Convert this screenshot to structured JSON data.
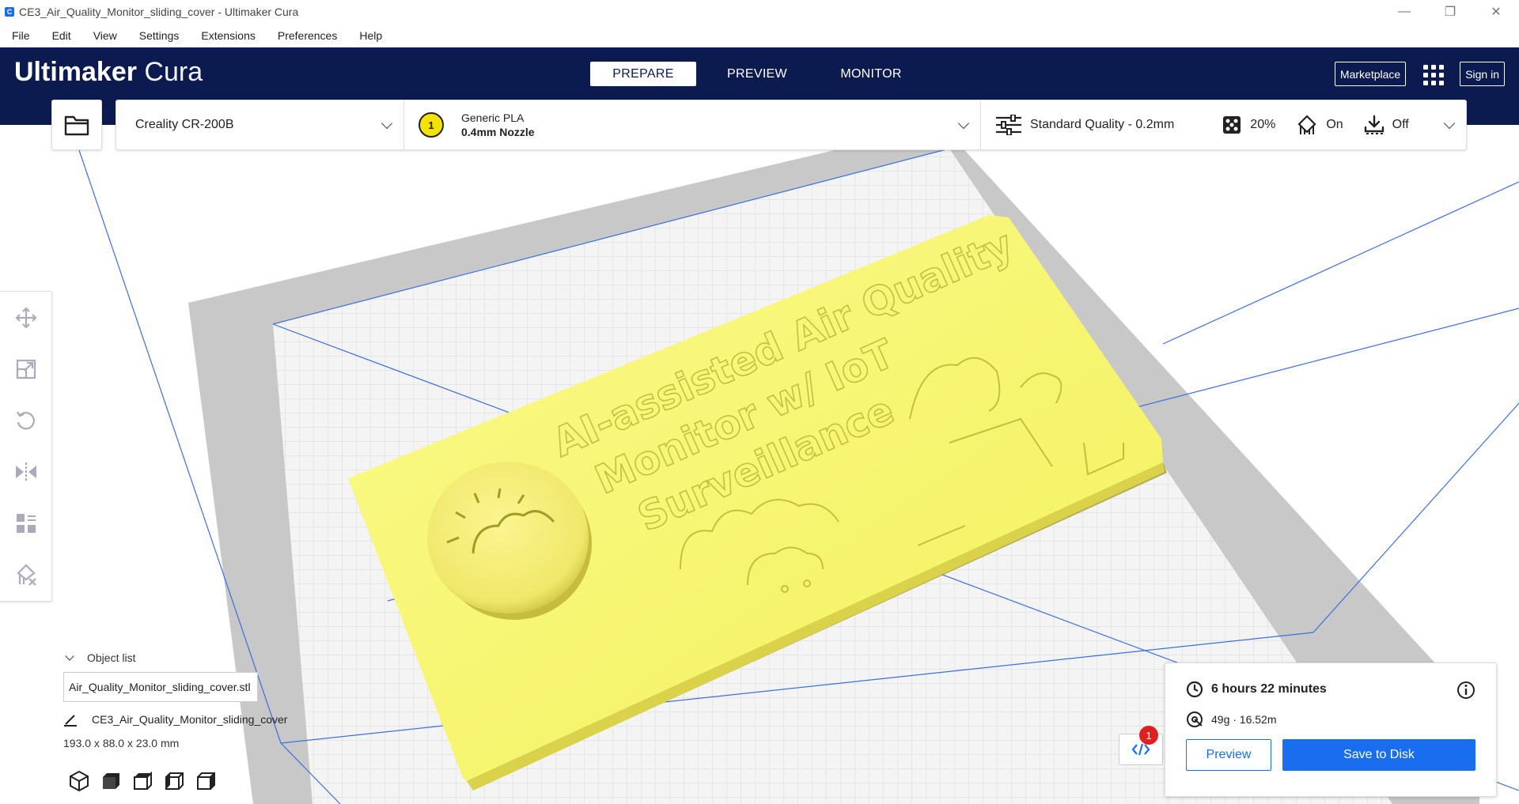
{
  "window": {
    "title": "CE3_Air_Quality_Monitor_sliding_cover - Ultimaker Cura",
    "app_icon": "C"
  },
  "menu": [
    {
      "label": "File"
    },
    {
      "label": "Edit"
    },
    {
      "label": "View"
    },
    {
      "label": "Settings"
    },
    {
      "label": "Extensions"
    },
    {
      "label": "Preferences"
    },
    {
      "label": "Help"
    }
  ],
  "header": {
    "brand_bold": "Ultimaker",
    "brand_light": "Cura",
    "stages": [
      {
        "label": "PREPARE",
        "active": true
      },
      {
        "label": "PREVIEW",
        "active": false
      },
      {
        "label": "MONITOR",
        "active": false
      }
    ],
    "marketplace_label": "Marketplace",
    "signin_label": "Sign in"
  },
  "printer": {
    "machine": "Creality CR-200B",
    "extruder_number": "1",
    "material": "Generic PLA",
    "nozzle": "0.4mm Nozzle",
    "quality": "Standard Quality - 0.2mm",
    "infill": "20%",
    "support": "On",
    "adhesion": "Off"
  },
  "object_list": {
    "header": "Object list",
    "file": "Air_Quality_Monitor_sliding_cover.stl",
    "name": "CE3_Air_Quality_Monitor_sliding_cover",
    "dimensions": "193.0 x 88.0 x 23.0 mm"
  },
  "model": {
    "text_line1": "AI-assisted Air Quality",
    "text_line2": "Monitor w/ IoT",
    "text_line3": "Surveillance",
    "color": "#f7f56a"
  },
  "print_info": {
    "time": "6 hours 22 minutes",
    "material_usage": "49g · 16.52m",
    "preview_label": "Preview",
    "save_label": "Save to Disk",
    "notification_count": "1"
  },
  "colors": {
    "header_bg": "#0c1b4f",
    "accent": "#196ef0",
    "build_volume_line": "#3b6fe0"
  }
}
